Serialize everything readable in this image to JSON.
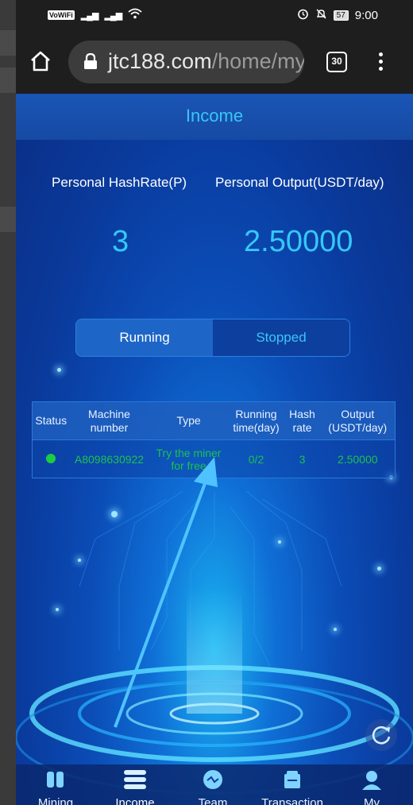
{
  "status_bar": {
    "vowifi": "VoWiFi",
    "battery": "57",
    "time": "9:00"
  },
  "browser": {
    "url_host": "jtc188.com",
    "url_path": "/home/my",
    "tab_count": "30"
  },
  "page": {
    "header_title": "Income",
    "personal_hashrate_label": "Personal HashRate(P)",
    "personal_output_label": "Personal Output(USDT/day)",
    "personal_hashrate_value": "3",
    "personal_output_value": "2.50000",
    "toggle": {
      "running": "Running",
      "stopped": "Stopped",
      "active": "Running"
    },
    "table": {
      "headers": [
        "Status",
        "Machine number",
        "Type",
        "Running time(day)",
        "Hash rate",
        "Output (USDT/day)"
      ],
      "rows": [
        {
          "status": "running",
          "machine_number": "A8098630922",
          "type": "Try the miner for free",
          "running_time": "0/2",
          "hash_rate": "3",
          "output": "2.50000"
        }
      ]
    }
  },
  "bottom_nav": [
    {
      "label": "Mining",
      "icon": "mining-icon"
    },
    {
      "label": "Income",
      "icon": "income-icon",
      "active": true
    },
    {
      "label": "Team",
      "icon": "team-icon"
    },
    {
      "label": "Transaction",
      "icon": "transaction-icon"
    },
    {
      "label": "My",
      "icon": "user-icon"
    }
  ],
  "colors": {
    "accent_cyan": "#35c8f8",
    "status_green": "#1dc24d",
    "page_blue": "#0a2f86"
  }
}
